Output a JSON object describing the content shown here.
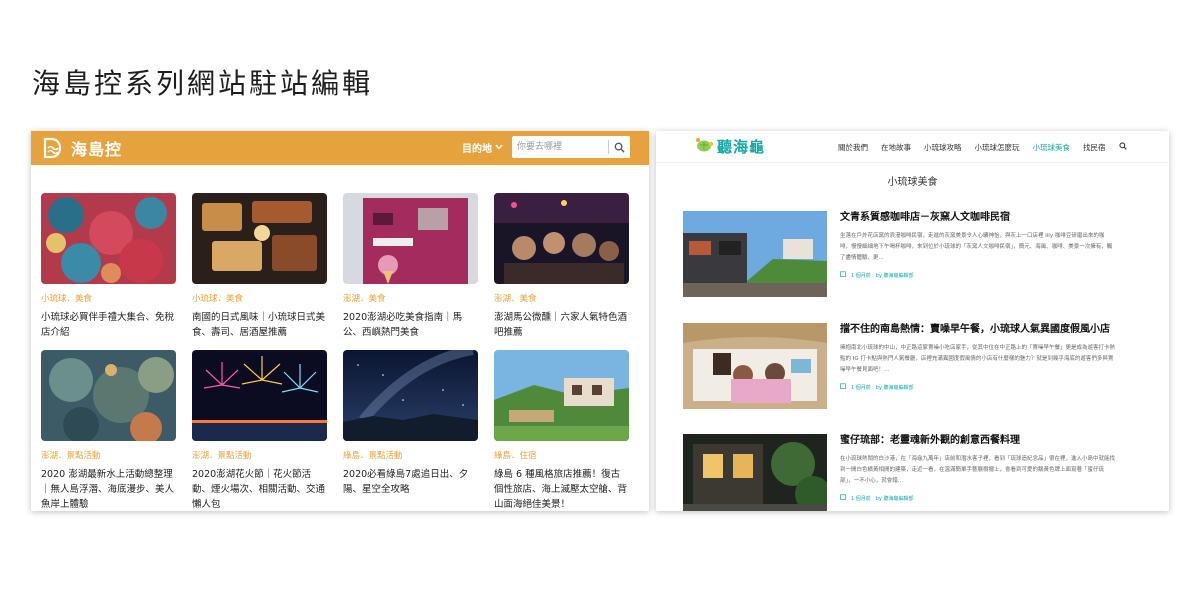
{
  "page": {
    "title": "海島控系列網站駐站編輯"
  },
  "left_site": {
    "logo_text": "海島控",
    "nav_label": "目的地",
    "search_placeholder": "你要去哪裡",
    "cards": [
      {
        "category": "小琉球．美食",
        "title": "小琉球必買伴手禮大集合、免稅店介紹"
      },
      {
        "category": "小琉球．美食",
        "title": "南國的日式風味｜小琉球日式美食、壽司、居酒屋推薦"
      },
      {
        "category": "澎湖．美食",
        "title": "2020澎湖必吃美食指南｜馬公、西嶼熱門美食"
      },
      {
        "category": "澎湖．美食",
        "title": "澎湖馬公微醺｜六家人氣特色酒吧推薦"
      },
      {
        "category": "澎湖．景點活動",
        "title": "2020 澎湖最新水上活動總整理｜無人島浮潛、海底漫步、美人魚岸上體驗"
      },
      {
        "category": "澎湖．景點活動",
        "title": "2020澎湖花火節｜花火節活動、煙火場次、相關活動、交通懶人包"
      },
      {
        "category": "綠島．景點活動",
        "title": "2020必看綠島7處追日出、夕陽、星空全攻略"
      },
      {
        "category": "綠島．住宿",
        "title": "綠島 6 種風格旅店推薦！復古個性旅店、海上滅壓太空艙、背山面海絕佳美景！"
      }
    ]
  },
  "right_site": {
    "logo_text": "聽海龜",
    "nav": [
      "關於我們",
      "在地故事",
      "小琉球攻略",
      "小琉球怎麼玩",
      "小琉球美食",
      "找民宿"
    ],
    "active_nav_index": 4,
    "heading": "小琉球美食",
    "posts": [
      {
        "title": "文青系質感咖啡店－灰窯人文咖啡民宿",
        "excerpt": "坐落在戶外花店窯的浪漫咖啡民宿，走進的灰窯美景令人心曠神怡，與灰上一口店裡 lily 咖啡豆研磨出來的咖啡，慢慢細細地下午喝杯咖啡，來到位於小琉球的「灰窯人文咖啡民宿」，簡元、海風、咖啡、美景一次擁有，飄了盡情體驗、更...",
        "meta_date": "1 個月前",
        "meta_author": "by 聽海龜編輯部"
      },
      {
        "title": "擋不住的南島熱情：賣噪早午餐，小琉球人氣異國度假風小店",
        "excerpt": "擁抱南北小琉球的中山，中正路這家賣噪小吃店家手，從其中位在中正路上的「賣噪早午餐」更是成為遊客打卡熱點的 IG 打卡點與熱門人氣餐廳，店裡充滿異國度假風情的小店有什麼樣的魅力？就是到幾乎海底的遊客們多與賣噪早午餐見面吧！...",
        "meta_date": "1 個月前",
        "meta_author": "by 聽海龜編輯部"
      },
      {
        "title": "蜜仔琉部：老靈魂新外觀的創意西餐料理",
        "excerpt": "在小琉球熱鬧的白沙港，在「海龜九萬年」店前和潛水客子裡，看到「琉球造紀念品」很在裡，進入小島中就能找到一間白色橘黃相間的建築，走近一看，在溫滿簡單手藝展樹擺上，會看到可愛的鵝黃色牌上面寫著「蜜仔琉部」，一不小心，就會錯...",
        "meta_date": "1 個月前",
        "meta_author": "by 聽海龜編輯部"
      }
    ]
  },
  "colors": {
    "brand_orange": "#e6a23c",
    "brand_teal": "#1aa6a6"
  },
  "icons": [
    "island-logo-icon",
    "chevron-down-icon",
    "search-icon",
    "turtle-logo-icon",
    "clock-icon"
  ]
}
